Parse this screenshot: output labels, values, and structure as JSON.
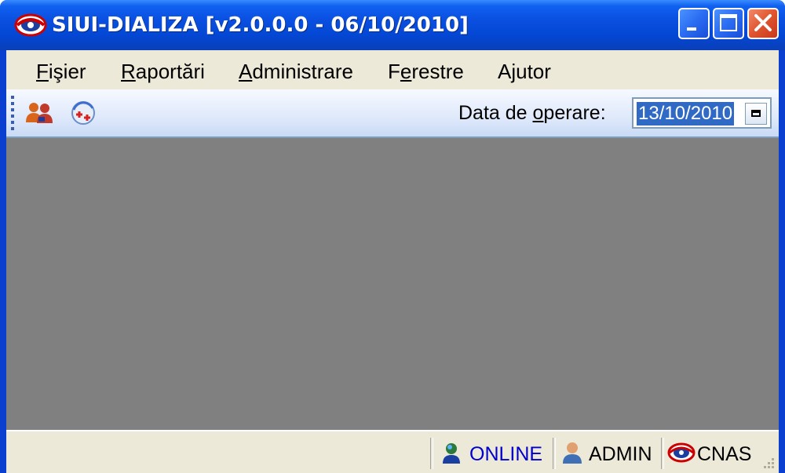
{
  "window": {
    "title": "SIUI-DIALIZA [v2.0.0.0 - 06/10/2010]",
    "app_icon": "eye-logo-icon",
    "controls": [
      "minimize-icon",
      "maximize-icon",
      "close-icon"
    ]
  },
  "menu": {
    "items": [
      {
        "label": "Fişier",
        "mnemonic": "F"
      },
      {
        "label": "Raportări",
        "mnemonic": "R"
      },
      {
        "label": "Administrare",
        "mnemonic": "A"
      },
      {
        "label": "Ferestre",
        "mnemonic": "e"
      },
      {
        "label": "Ajutor",
        "mnemonic": "j"
      }
    ]
  },
  "toolbar": {
    "tools": [
      "users-icon",
      "medical-refresh-icon"
    ],
    "date_label": "Data de operare:",
    "date_value": "13/10/2010"
  },
  "status": {
    "connection": "ONLINE",
    "user": "ADMIN",
    "organization": "CNAS",
    "connection_color": "#0000cc"
  }
}
